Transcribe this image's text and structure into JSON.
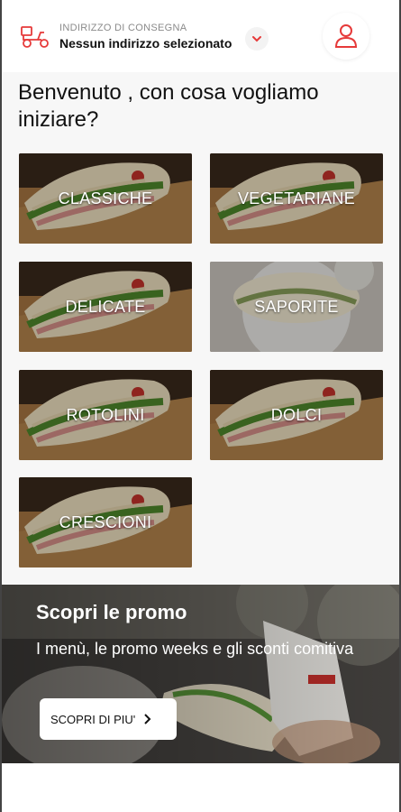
{
  "header": {
    "address_label": "INDIRIZZO DI CONSEGNA",
    "address_value": "Nessun indirizzo selezionato"
  },
  "welcome_text": "Benvenuto , con cosa vogliamo iniziare?",
  "categories": [
    {
      "label": "CLASSICHE"
    },
    {
      "label": "VEGETARIANE"
    },
    {
      "label": "DELICATE"
    },
    {
      "label": "SAPORITE"
    },
    {
      "label": "ROTOLINI"
    },
    {
      "label": "DOLCI"
    },
    {
      "label": "CRESCIONI"
    }
  ],
  "promo": {
    "title": "Scopri le promo",
    "text": "I menù, le promo weeks e gli sconti comitiva",
    "button_label": "SCOPRI DI PIU'"
  },
  "colors": {
    "accent": "#e63a3a"
  },
  "icons": {
    "delivery": "scooter-icon",
    "account": "user-icon",
    "dropdown": "chevron-down-icon",
    "arrow": "chevron-right-icon"
  }
}
